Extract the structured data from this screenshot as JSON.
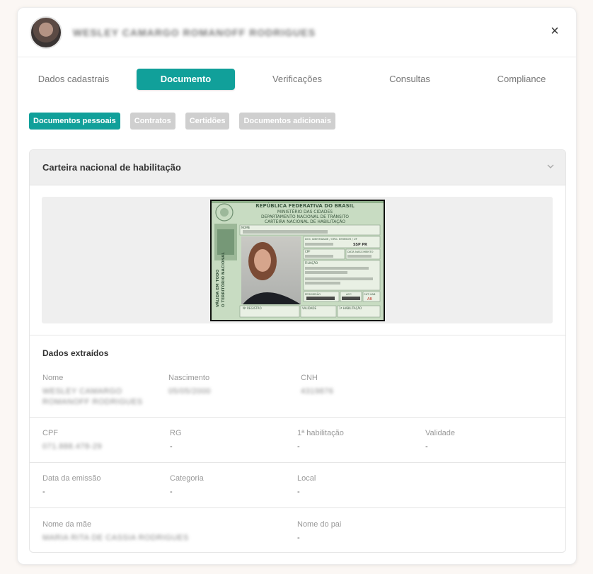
{
  "header": {
    "name": "WESLEY CAMARGO ROMANOFF RODRIGUES",
    "close_glyph": "×"
  },
  "tabs": [
    {
      "label": "Dados cadastrais",
      "active": false
    },
    {
      "label": "Documento",
      "active": true
    },
    {
      "label": "Verificações",
      "active": false
    },
    {
      "label": "Consultas",
      "active": false
    },
    {
      "label": "Compliance",
      "active": false
    }
  ],
  "subtabs": [
    {
      "label": "Documentos pessoais",
      "active": true
    },
    {
      "label": "Contratos",
      "active": false
    },
    {
      "label": "Certidões",
      "active": false
    },
    {
      "label": "Documentos adicionais",
      "active": false
    }
  ],
  "card": {
    "title": "Carteira nacional de habilitação",
    "document": {
      "line1": "REPÚBLICA FEDERATIVA DO BRASIL",
      "line2": "MINISTÉRIO DAS CIDADES",
      "line3": "DEPARTAMENTO NACIONAL DE TRÂNSITO",
      "line4": "CARTEIRA NACIONAL DE HABILITAÇÃO",
      "nome_label": "NOME",
      "doc_label": "DOC IDENTIDADE / ORG. EMISSOR / UF",
      "doc_uf": "SSP PR",
      "cpf_label": "CPF",
      "nasc_label": "DATA NASCIMENTO",
      "filiacao_label": "FILIAÇÃO",
      "permissao_label": "PERMISSÃO",
      "acc_label": "ACC",
      "cathab_label": "CAT HAB",
      "cathab_value": "AB",
      "registro_label": "Nº REGISTRO",
      "validade_label": "VALIDADE",
      "primeira_label": "1ª HABILITAÇÃO",
      "side_text1": "VÁLIDA EM TODO",
      "side_text2": "O TERRITÓRIO NACIONAL"
    },
    "extracted_title": "Dados extraídos",
    "fields": {
      "nome": {
        "label": "Nome",
        "value": "WESLEY CAMARGO ROMANOFF RODRIGUES"
      },
      "nascimento": {
        "label": "Nascimento",
        "value": "05/05/2000"
      },
      "cnh": {
        "label": "CNH",
        "value": "4319876"
      },
      "cpf": {
        "label": "CPF",
        "value": "071.888.478-29"
      },
      "rg": {
        "label": "RG",
        "value": "-"
      },
      "primeira_habilitacao": {
        "label": "1ª habilitação",
        "value": "-"
      },
      "validade": {
        "label": "Validade",
        "value": "-"
      },
      "data_emissao": {
        "label": "Data da emissão",
        "value": "-"
      },
      "categoria": {
        "label": "Categoria",
        "value": "-"
      },
      "local": {
        "label": "Local",
        "value": "-"
      },
      "nome_mae": {
        "label": "Nome da mãe",
        "value": "MARIA RITA DE CASSIA RODRIGUES"
      },
      "nome_pai": {
        "label": "Nome do pai",
        "value": "-"
      }
    }
  },
  "colors": {
    "accent": "#11a09a",
    "inactive_chip": "#cfcfcf",
    "card_header": "#efefef",
    "license_green": "#c7dcc1"
  },
  "icons": {
    "close": "close-icon",
    "chevron": "chevron-down-icon",
    "avatar": "avatar"
  }
}
